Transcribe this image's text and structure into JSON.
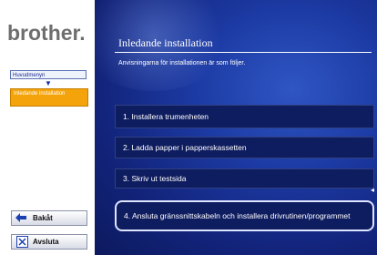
{
  "brand": {
    "logo_text": "brother."
  },
  "sidebar": {
    "main_menu_label": "Huvudmenyn",
    "current_label": "Inledande installation",
    "back_label": "Bakåt",
    "exit_label": "Avsluta"
  },
  "main": {
    "title": "Inledande installation",
    "subtitle": "Anvisningarna för installationen är som följer.",
    "options": [
      {
        "label": "1. Installera trumenheten"
      },
      {
        "label": "2. Ladda papper i papperskassetten"
      },
      {
        "label": "3. Skriv ut testsida"
      },
      {
        "label": "4. Ansluta gränssnittskabeln och installera drivrutinen/programmet"
      }
    ]
  },
  "colors": {
    "main_bg": "#1c3aa3",
    "current_item_bg": "#f4a40a",
    "logo_gray": "#6e6e6e"
  }
}
